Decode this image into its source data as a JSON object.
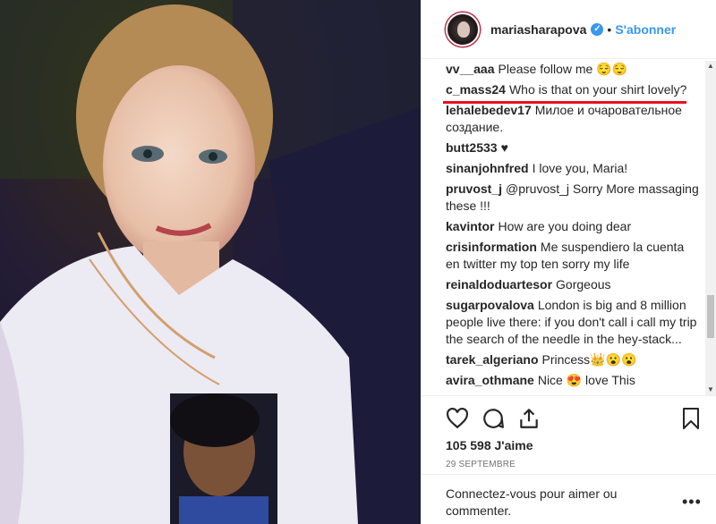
{
  "post": {
    "username": "mariasharapova",
    "verified_icon": "verified-badge-icon",
    "separator": "•",
    "follow_label": "S'abonner"
  },
  "comments": [
    {
      "user": "vv__aaa",
      "text": "Please follow me 😌😌"
    },
    {
      "user": "c_mass24",
      "text": "Who is that on your shirt lovely?"
    },
    {
      "user": "lehalebedev17",
      "text": "Милое и очаровательное создание."
    },
    {
      "user": "butt2533",
      "text": "♥"
    },
    {
      "user": "sinanjohnfred",
      "text": "I love you, Maria!"
    },
    {
      "user": "pruvost_j",
      "text": "@pruvost_j Sorry More massaging these !!!"
    },
    {
      "user": "kavintor",
      "text": "How are you doing dear"
    },
    {
      "user": "crisinformation",
      "text": "Me suspendiero la cuenta en twitter my top ten sorry my life"
    },
    {
      "user": "reinaldoduartesor",
      "text": "Gorgeous"
    },
    {
      "user": "sugarpovalova",
      "text": "London is big and 8 million people live there: if you don't call i call my trip the search of the needle in the hey-stack..."
    },
    {
      "user": "tarek_algeriano",
      "text": "Princess👑😮😮"
    },
    {
      "user": "avira_othmane",
      "text": "Nice 😍 love This"
    }
  ],
  "actions": {
    "like_icon": "heart-icon",
    "comment_icon": "comment-bubble-icon",
    "share_icon": "share-icon",
    "save_icon": "bookmark-icon",
    "likes": "105 598 J'aime",
    "date": "29 SEPTEMBRE"
  },
  "login": {
    "link": "Connectez-vous",
    "text": " pour aimer ou commenter.",
    "more_label": "•••"
  },
  "colors": {
    "accent": "#3897f0",
    "highlight_line": "#e8101b"
  }
}
